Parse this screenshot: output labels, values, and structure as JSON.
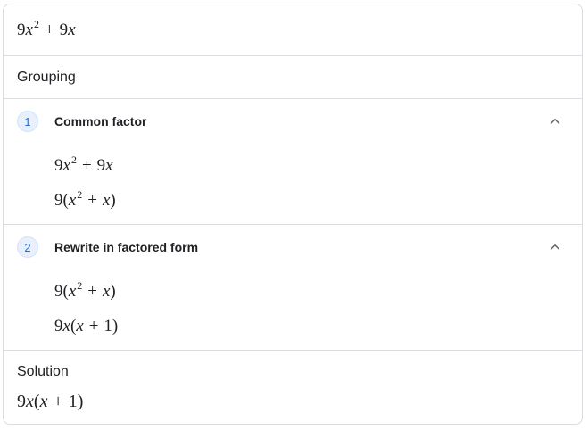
{
  "problem": {
    "coef1": "9",
    "var1": "x",
    "exp1": "2",
    "op": "+",
    "coef2": "9",
    "var2": "x"
  },
  "method": {
    "label": "Grouping"
  },
  "steps": [
    {
      "number": "1",
      "title": "Common factor",
      "icon": "chevron-up-icon",
      "lines": [
        {
          "a": "9",
          "b": "x",
          "exp": "2",
          "op": "+",
          "c": "9",
          "d": "x"
        },
        {
          "a": "9(",
          "b": "x",
          "exp": "2",
          "op": "+",
          "c": "",
          "d": "x",
          "close": ")"
        }
      ]
    },
    {
      "number": "2",
      "title": "Rewrite in factored form",
      "icon": "chevron-up-icon",
      "lines": [
        {
          "a": "9(",
          "b": "x",
          "exp": "2",
          "op": "+",
          "c": "",
          "d": "x",
          "close": ")"
        },
        {
          "a": "9",
          "b": "x",
          "open": "(",
          "c": "x",
          "op": "+",
          "d": "1",
          "close": ")"
        }
      ]
    }
  ],
  "solution": {
    "label": "Solution",
    "a": "9",
    "b": "x",
    "open": "(",
    "c": "x",
    "op": "+",
    "d": "1",
    "close": ")"
  },
  "colors": {
    "accent": "#1a73e8",
    "badge_bg": "#e8f0fe",
    "divider": "#dadce0",
    "text": "#202124"
  }
}
